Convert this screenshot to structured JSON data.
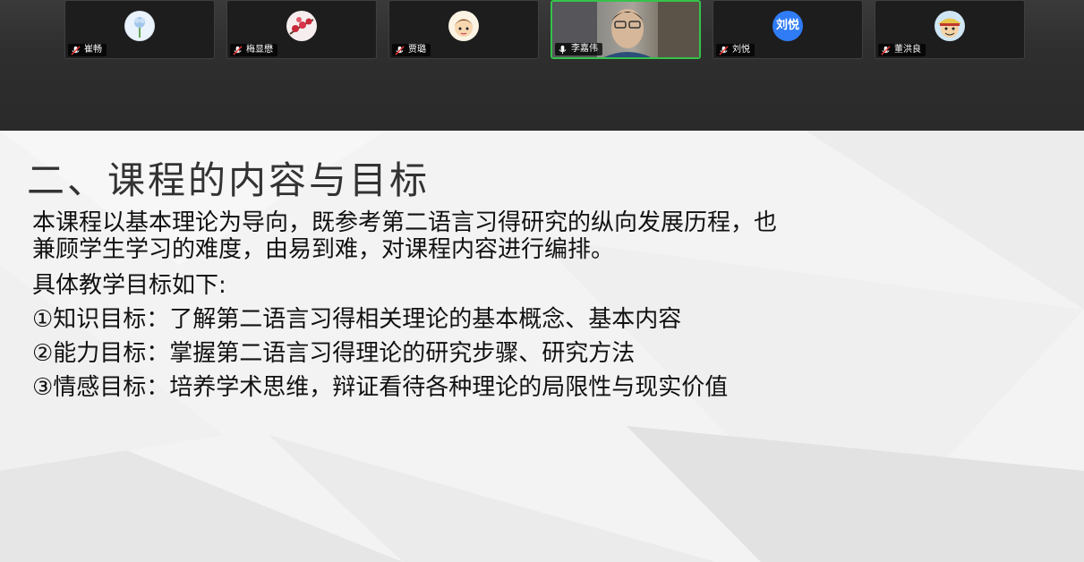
{
  "participants": [
    {
      "name": "崔畅",
      "avatar": "flower-icon"
    },
    {
      "name": "梅显懋",
      "avatar": "plum-blossom-icon"
    },
    {
      "name": "贾璐",
      "avatar": "cartoon-girl-icon"
    },
    {
      "name": "李嘉伟",
      "avatar": "video",
      "active": true
    },
    {
      "name": "刘悦",
      "avatar_text": "刘悦"
    },
    {
      "name": "董洪良",
      "avatar": "cartoon-boy-icon"
    }
  ],
  "slide": {
    "title": "二、课程的内容与目标",
    "intro_line1": "本课程以基本理论为导向，既参考第二语言习得研究的纵向发展历程，也",
    "intro_line2": "兼顾学生学习的难度，由易到难，对课程内容进行编排。",
    "goals_heading": "具体教学目标如下:",
    "goals": [
      "①知识目标：了解第二语言习得相关理论的基本概念、基本内容",
      "②能力目标：掌握第二语言习得理论的研究步骤、研究方法",
      "③情感目标：培养学术思维，辩证看待各种理论的局限性与现实价值"
    ]
  },
  "colors": {
    "active_border": "#36c24b",
    "avatar_blue": "#2f7cf6",
    "slide_background": "#f4f4f4"
  }
}
